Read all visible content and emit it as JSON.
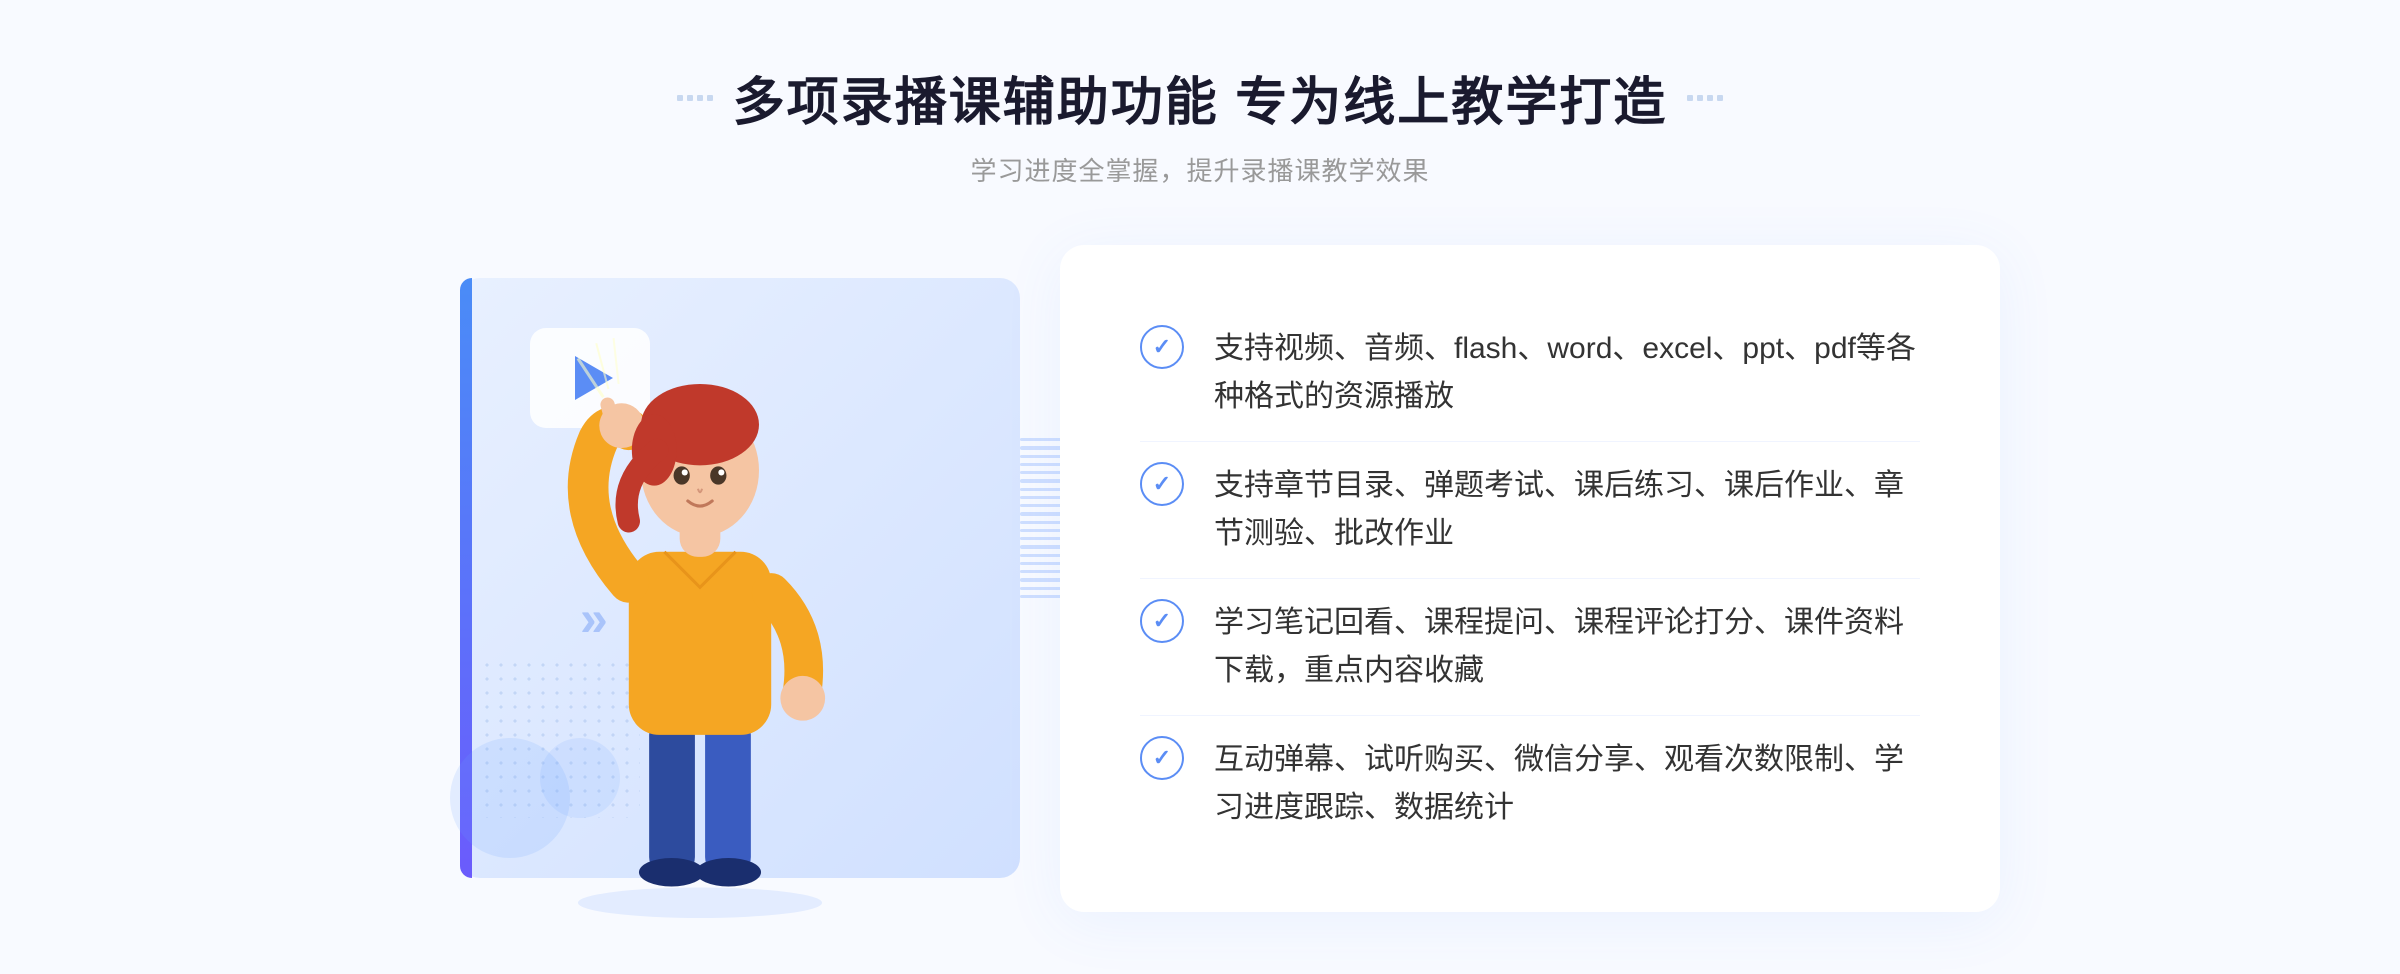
{
  "header": {
    "title": "多项录播课辅助功能 专为线上教学打造",
    "subtitle": "学习进度全掌握，提升录播课教学效果",
    "decorator_dots": [
      "·",
      "·",
      "·",
      "·"
    ]
  },
  "features": [
    {
      "id": 1,
      "text": "支持视频、音频、flash、word、excel、ppt、pdf等各种格式的资源播放"
    },
    {
      "id": 2,
      "text": "支持章节目录、弹题考试、课后练习、课后作业、章节测验、批改作业"
    },
    {
      "id": 3,
      "text": "学习笔记回看、课程提问、课程评论打分、课件资料下载，重点内容收藏"
    },
    {
      "id": 4,
      "text": "互动弹幕、试听购买、微信分享、观看次数限制、学习进度跟踪、数据统计"
    }
  ],
  "colors": {
    "primary": "#5b8df5",
    "accent": "#4a8cf7",
    "text_dark": "#1a1a2e",
    "text_gray": "#999999",
    "text_body": "#333333",
    "bg_light": "#f8faff",
    "border_light": "#f0f4ff"
  }
}
